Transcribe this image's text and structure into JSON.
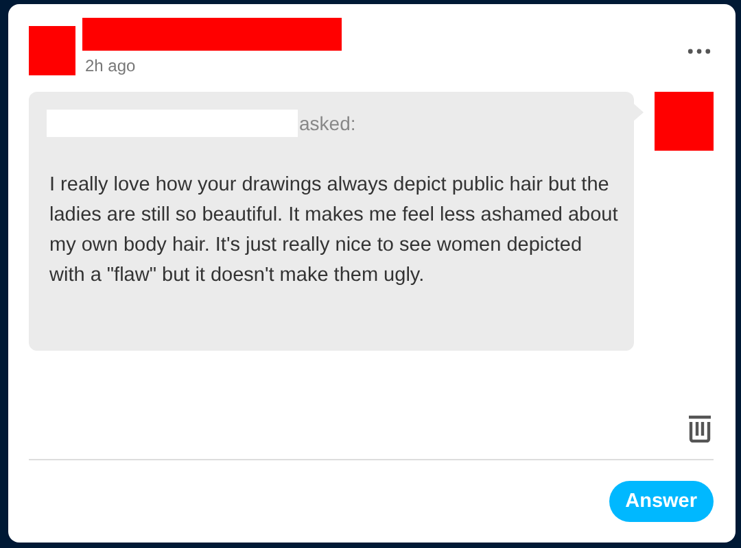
{
  "post": {
    "time": "2h ago"
  },
  "ask": {
    "asked_label": "asked:",
    "text": "I really love how your drawings always depict public hair but the ladies are still so beautiful.  It makes me feel less ashamed about my own body hair.  It's just really nice to see women depicted with a \"flaw\" but it doesn't make them ugly."
  },
  "buttons": [
    "Answer"
  ]
}
